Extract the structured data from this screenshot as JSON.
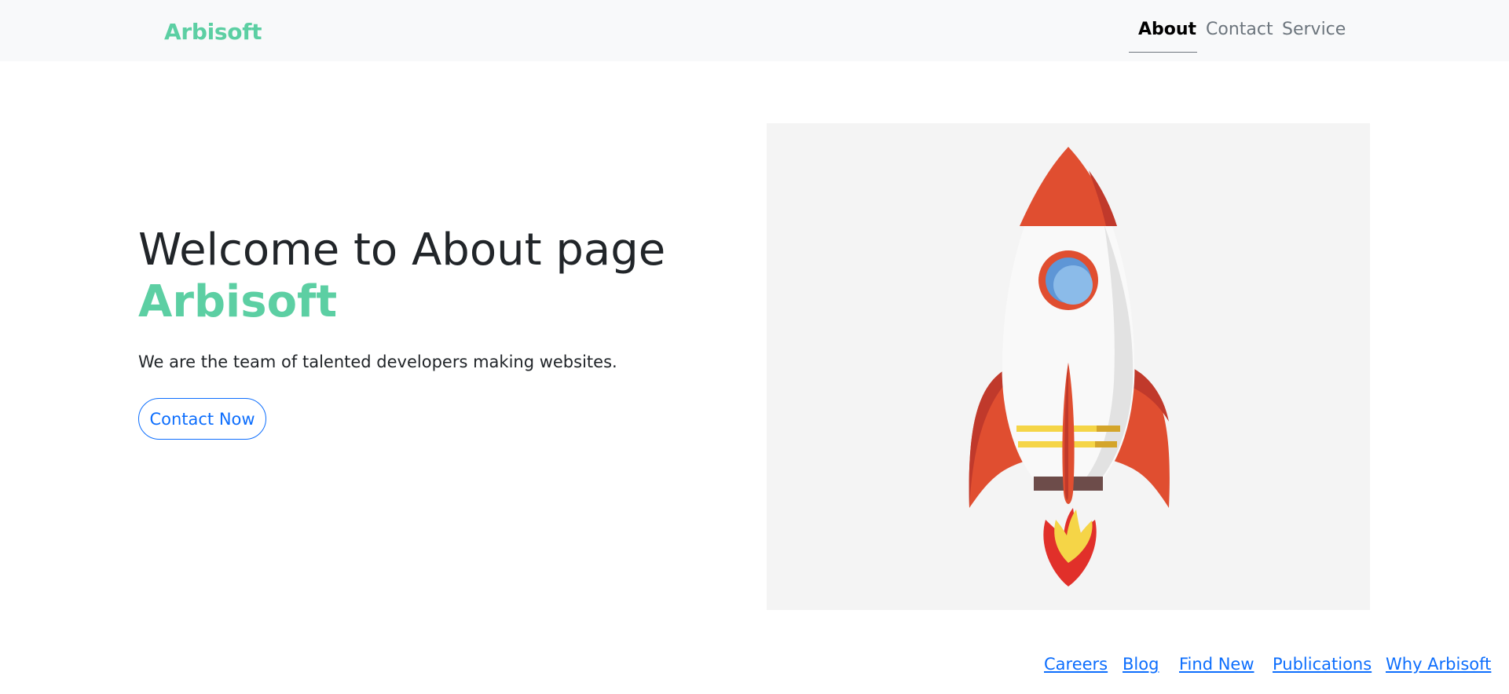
{
  "navbar": {
    "brand": "Arbisoft",
    "links": [
      {
        "label": "About",
        "active": true
      },
      {
        "label": "Contact",
        "active": false
      },
      {
        "label": "Service",
        "active": false
      }
    ]
  },
  "hero": {
    "title": "Welcome to About page",
    "brand": "Arbisoft",
    "description": "We are the team of talented developers making websites.",
    "button_label": "Contact Now",
    "image_icon": "rocket-illustration"
  },
  "footer": {
    "links": [
      "Careers",
      "Blog",
      "Find New",
      "Publications",
      "Why Arbisoft"
    ]
  },
  "colors": {
    "brand": "#5ccfa3",
    "link": "#0d6efd",
    "navbar_bg": "#f8f9fa",
    "rocket_red": "#e04e30",
    "rocket_window": "#7fb4e6"
  }
}
